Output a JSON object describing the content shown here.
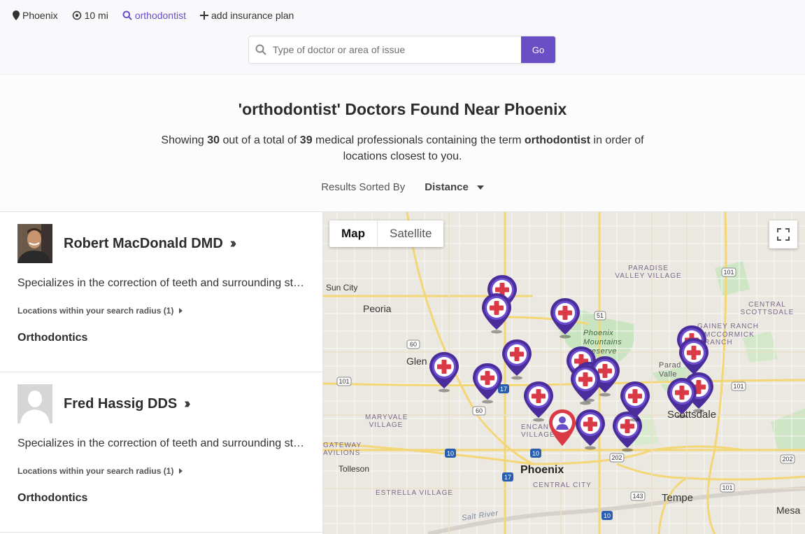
{
  "filters": {
    "location": "Phoenix",
    "radius": "10 mi",
    "term": "orthodontist",
    "insurance": "add insurance plan"
  },
  "search": {
    "placeholder": "Type of doctor or area of issue",
    "go_label": "Go"
  },
  "heading": {
    "title": "'orthodontist' Doctors Found Near Phoenix",
    "showing_prefix": "Showing",
    "shown_count": "30",
    "out_of": "out of a total of",
    "total_count": "39",
    "containing": "medical professionals containing the term",
    "term": "orthodontist",
    "suffix": "in order of locations closest to you."
  },
  "sort": {
    "label": "Results Sorted By",
    "value": "Distance"
  },
  "results": [
    {
      "name": "Robert MacDonald DMD",
      "description": "Specializes in the correction of teeth and surrounding structures.",
      "locations_label": "Locations within your search radius (1)",
      "specialty": "Orthodontics"
    },
    {
      "name": "Fred Hassig DDS",
      "description": "Specializes in the correction of teeth and surrounding structures.",
      "locations_label": "Locations within your search radius (1)",
      "specialty": "Orthodontics"
    }
  ],
  "map": {
    "type_map": "Map",
    "type_satellite": "Satellite",
    "places": {
      "phoenix": "Phoenix",
      "scottsdale": "Scottsdale",
      "tempe": "Tempe",
      "mesa": "Mesa",
      "peoria": "Peoria",
      "sun_city": "Sun City",
      "glendale": "Glen",
      "tolleson": "Tolleson",
      "paradise_valley_village": "PARADISE VALLEY VILLAGE",
      "central_scottsdale": "CENTRAL SCOTTSDALE",
      "phoenix_mountains": "Phoenix Mountains Preserve",
      "maryvale": "MARYVALE VILLAGE",
      "estrella": "ESTRELLA VILLAGE",
      "central_city": "CENTRAL CITY",
      "encanto": "ENCANTO VILLAGE",
      "gainey": "GAINEY RANCH",
      "mccormick": "MCCORMICK RANCH",
      "paradise": "Parad Valle",
      "gateway": "GATEWAY AVILIONS",
      "salt_river": "Salt River"
    },
    "shields": [
      "101",
      "51",
      "60",
      "17",
      "10",
      "202",
      "143",
      "101",
      "101",
      "101",
      "60",
      "10"
    ]
  }
}
